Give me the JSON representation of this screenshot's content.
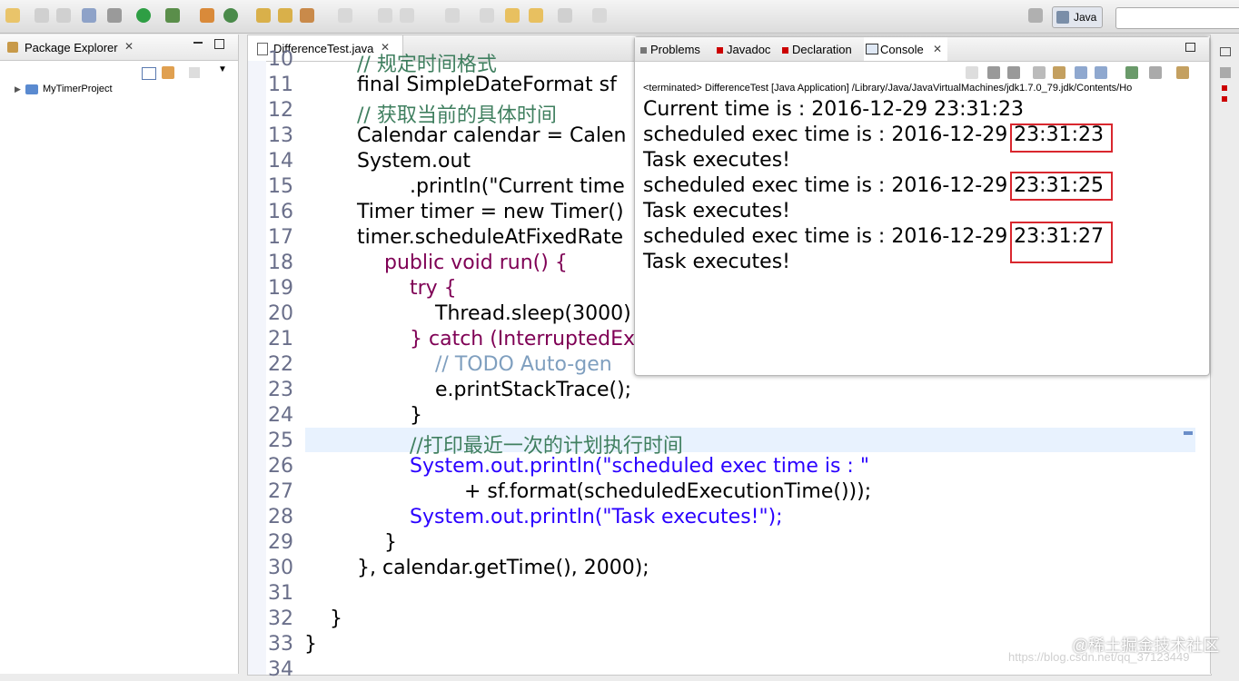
{
  "toolbar": {
    "perspective_label": "Java",
    "search_placeholder": ""
  },
  "package_explorer": {
    "title": "Package Explorer",
    "project": "MyTimerProject"
  },
  "editor": {
    "tab_title": "DifferenceTest.java",
    "lines": [
      {
        "num": "10",
        "text": "// 规定时间格式"
      },
      {
        "num": "11",
        "text": "final SimpleDateFormat sf"
      },
      {
        "num": "12",
        "text": "// 获取当前的具体时间"
      },
      {
        "num": "13",
        "text": "Calendar calendar = Calen"
      },
      {
        "num": "14",
        "text": "System.out"
      },
      {
        "num": "15",
        "text": ".println(\"Current time"
      },
      {
        "num": "16",
        "text": "Timer timer = new Timer()"
      },
      {
        "num": "17",
        "text": "timer.scheduleAtFixedRate"
      },
      {
        "num": "18",
        "text": "public void run() {"
      },
      {
        "num": "19",
        "text": "try {"
      },
      {
        "num": "20",
        "text": "Thread.sleep(3000)"
      },
      {
        "num": "21",
        "text": "} catch (InterruptedEx"
      },
      {
        "num": "22",
        "text": "// TODO Auto-gen"
      },
      {
        "num": "23",
        "text": "e.printStackTrace();"
      },
      {
        "num": "24",
        "text": "}"
      },
      {
        "num": "25",
        "text": "//打印最近一次的计划执行时间"
      },
      {
        "num": "26",
        "text": "System.out.println(\"scheduled exec time is : \""
      },
      {
        "num": "27",
        "text": "+ sf.format(scheduledExecutionTime()));"
      },
      {
        "num": "28",
        "text": "System.out.println(\"Task executes!\");"
      },
      {
        "num": "29",
        "text": "}"
      },
      {
        "num": "30",
        "text": "}, calendar.getTime(), 2000);"
      },
      {
        "num": "31",
        "text": ""
      },
      {
        "num": "32",
        "text": "}"
      },
      {
        "num": "33",
        "text": "}"
      },
      {
        "num": "34",
        "text": ""
      }
    ]
  },
  "console": {
    "tabs": [
      "Problems",
      "Javadoc",
      "Declaration",
      "Console"
    ],
    "terminated": "<terminated> DifferenceTest [Java Application] /Library/Java/JavaVirtualMachines/jdk1.7.0_79.jdk/Contents/Ho",
    "output": [
      "Current time is : 2016-12-29 23:31:23",
      "scheduled exec time is : 2016-12-29 23:31:23",
      "Task executes!",
      "scheduled exec time is : 2016-12-29 23:31:25",
      "Task executes!",
      "scheduled exec time is : 2016-12-29 23:31:27",
      "Task executes!"
    ]
  },
  "watermark": {
    "text": "@稀土掘金技术社区",
    "url": "https://blog.csdn.net/qq_37123449"
  },
  "colors": {
    "keyword": "#7f0055",
    "string": "#2a00ff",
    "comment": "#3f7f5f",
    "field": "#0000c0",
    "highlight_box": "#d9272e"
  }
}
